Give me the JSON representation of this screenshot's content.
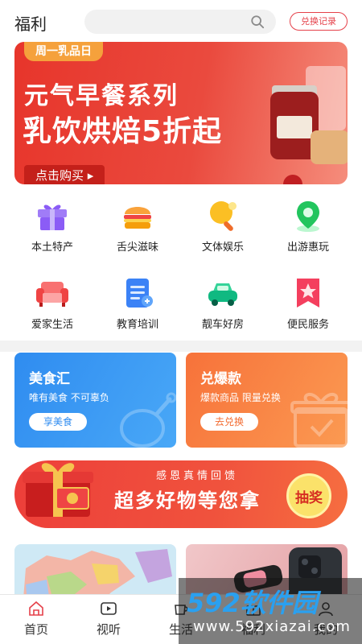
{
  "header": {
    "title": "福利",
    "search_placeholder": "",
    "redeem_label": "兑换记录"
  },
  "banner": {
    "tag": "周一乳品日",
    "headline": "元气早餐系列",
    "subheadline": "乳饮烘焙5折起",
    "cta": "点击购买 ▸"
  },
  "categories": [
    {
      "label": "本土特产",
      "icon": "gift-icon",
      "color": "#8b5cf6"
    },
    {
      "label": "舌尖滋味",
      "icon": "burger-icon",
      "color": "#f59e0b"
    },
    {
      "label": "文体娱乐",
      "icon": "pingpong-icon",
      "color": "#f59e0b"
    },
    {
      "label": "出游惠玩",
      "icon": "location-pin-icon",
      "color": "#22c55e"
    },
    {
      "label": "爱家生活",
      "icon": "sofa-icon",
      "color": "#ef4444"
    },
    {
      "label": "教育培训",
      "icon": "document-icon",
      "color": "#3b82f6"
    },
    {
      "label": "靓车好房",
      "icon": "car-icon",
      "color": "#10b981"
    },
    {
      "label": "便民服务",
      "icon": "star-bookmark-icon",
      "color": "#f43f5e"
    }
  ],
  "promo_cards": {
    "food": {
      "title": "美食汇",
      "subtitle": "唯有美食 不可辜负",
      "button": "享美食"
    },
    "hot": {
      "title": "兑爆款",
      "subtitle": "爆款商品 限量兑换",
      "button": "去兑换"
    }
  },
  "lottery": {
    "subtitle": "感恩真情回馈",
    "headline": "超多好物等您拿",
    "button": "抽奖"
  },
  "tabbar": {
    "items": [
      {
        "label": "首页",
        "icon": "home-icon"
      },
      {
        "label": "视听",
        "icon": "play-icon"
      },
      {
        "label": "生活",
        "icon": "cup-icon"
      },
      {
        "label": "福利",
        "icon": "gift-tab-icon"
      },
      {
        "label": "我的",
        "icon": "user-icon"
      }
    ]
  },
  "watermark": {
    "brand": "592软件园",
    "url": "www.592xiazai.com"
  }
}
